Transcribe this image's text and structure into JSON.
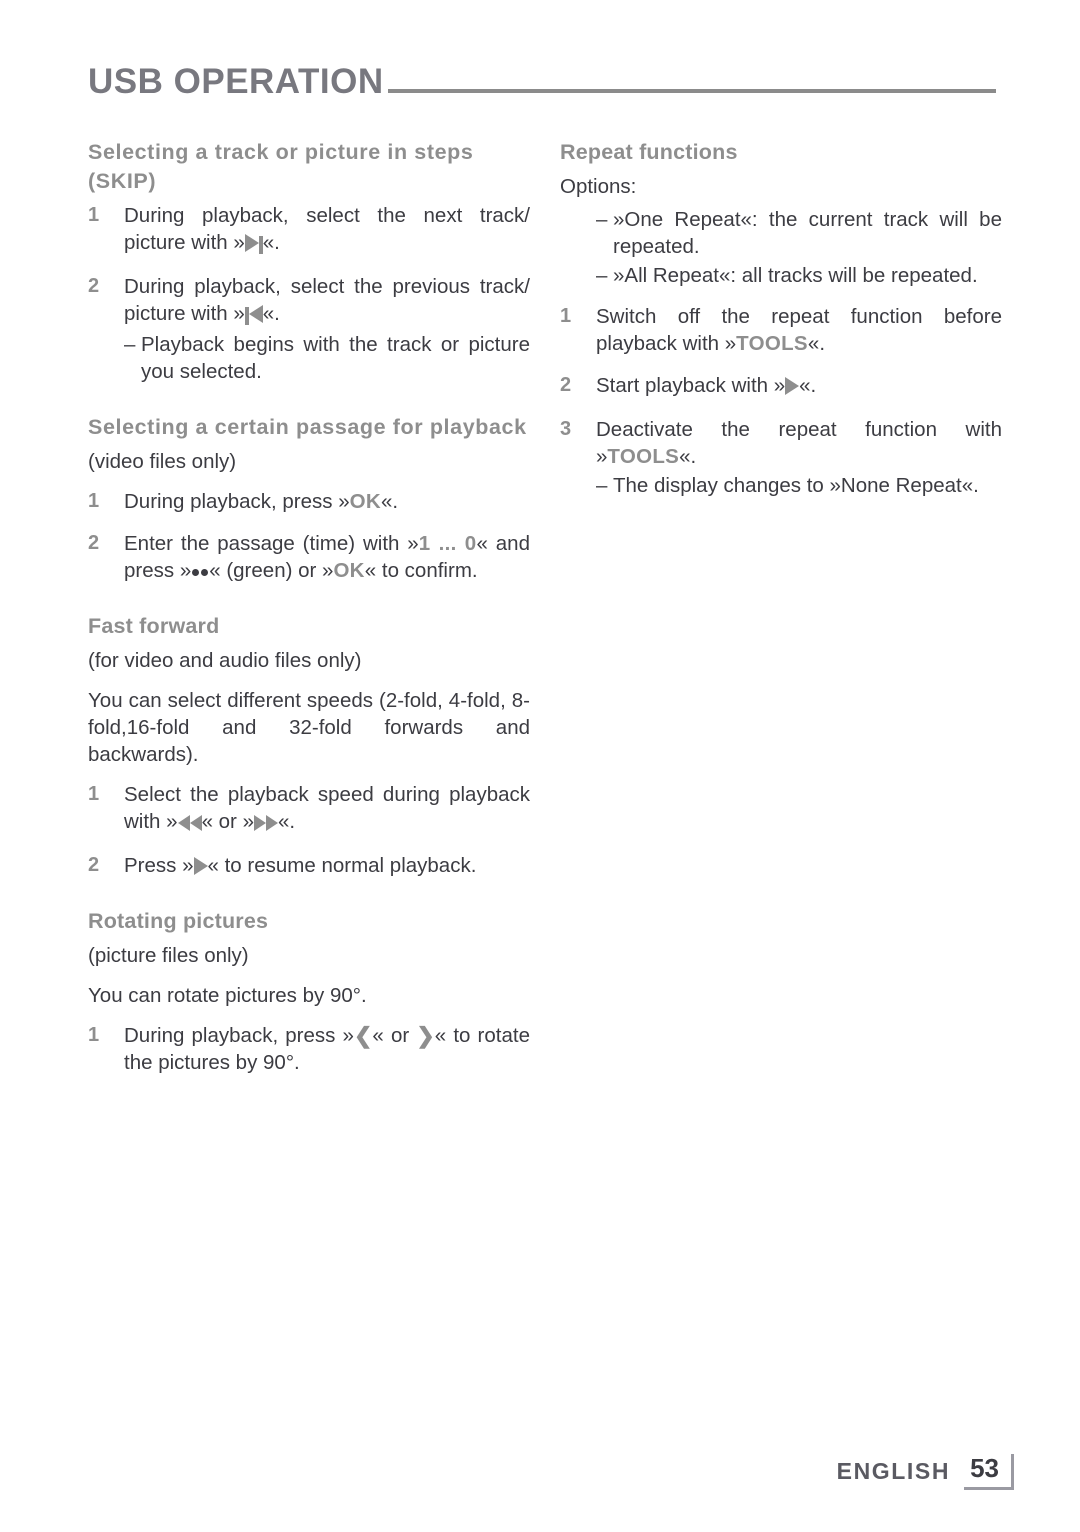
{
  "header": {
    "title": "USB OPERATION"
  },
  "left_column": {
    "sections": [
      {
        "heading": "Selecting a track or picture in steps (SKIP)",
        "steps": [
          {
            "num": "1",
            "text_before": "During playback, select the next track/ picture with »",
            "icon": "skip-next-icon",
            "text_after": "«."
          },
          {
            "num": "2",
            "text_before": "During playback, select the previous track/ picture with »",
            "icon": "skip-previous-icon",
            "text_after": "«.",
            "sub": "Playback begins with the track or picture you selected."
          }
        ]
      },
      {
        "heading": "Selecting a certain passage for playback",
        "note": "(video files only)",
        "steps": [
          {
            "num": "1",
            "prefix": "During playback, press »",
            "key": "OK",
            "suffix": "«."
          },
          {
            "num": "2",
            "p1": "Enter the passage (time) with »",
            "k1": "1 ... 0",
            "p2": "« and press »",
            "icon": "green-button-icon",
            "p3": "« (green) or »",
            "k2": "OK",
            "p4": "« to confirm."
          }
        ]
      },
      {
        "heading": "Fast forward",
        "note": "(for video and audio files only)",
        "body": "You can select different speeds (2-fold, 4-fold, 8-fold,16-fold and 32-fold forwards and backwards).",
        "steps": [
          {
            "num": "1",
            "p1": "Select the playback speed during playback with »",
            "icon1": "rewind-icon",
            "p2": "« or »",
            "icon2": "fast-forward-icon",
            "p3": "«."
          },
          {
            "num": "2",
            "p1": "Press »",
            "icon1": "play-icon",
            "p2": "« to resume normal playback."
          }
        ]
      },
      {
        "heading": "Rotating pictures",
        "note": "(picture files only)",
        "body": "You can rotate pictures by 90°.",
        "steps": [
          {
            "num": "1",
            "p1": "During playback, press »",
            "icon1": "left-arrow-icon",
            "p2": "« or ",
            "icon2": "right-arrow-icon",
            "p3": "« to rotate the pictures by 90°."
          }
        ]
      }
    ]
  },
  "right_column": {
    "sections": [
      {
        "heading": "Repeat functions",
        "note": "Options:",
        "options": [
          "»One Repeat«: the current track will be repeated.",
          "»All Repeat«: all tracks will be repeated."
        ],
        "steps": [
          {
            "num": "1",
            "p1": "Switch off the repeat function before playback with »",
            "key": "TOOLS",
            "p2": "«."
          },
          {
            "num": "2",
            "p1": "Start playback with »",
            "icon1": "play-icon",
            "p2": "«."
          },
          {
            "num": "3",
            "p1": "Deactivate the repeat function with »",
            "key": "TOOLS",
            "p2": "«.",
            "sub": "The display changes to »None Repeat«."
          }
        ]
      }
    ]
  },
  "footer": {
    "language": "ENGLISH",
    "page_number": "53"
  },
  "colors": {
    "title": "#78787f",
    "heading": "#8e8e8e",
    "body": "#3c3c42",
    "rule": "#8b8b8b",
    "key": "#8e8e8e"
  }
}
